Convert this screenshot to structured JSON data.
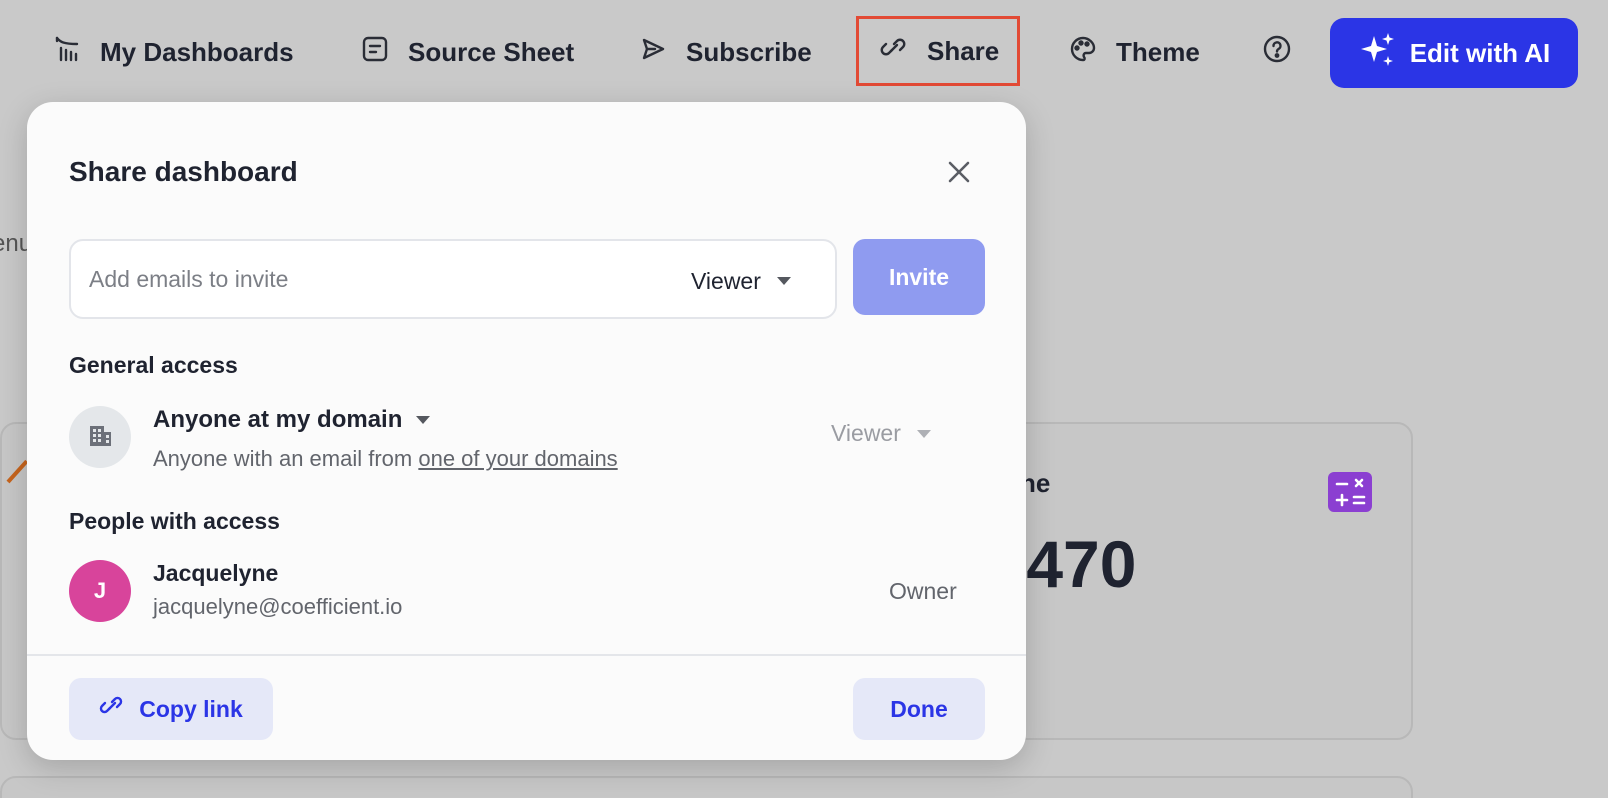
{
  "nav": {
    "dashboards_label": "My Dashboards",
    "source_label": "Source Sheet",
    "subscribe_label": "Subscribe",
    "share_label": "Share",
    "theme_label": "Theme",
    "edit_ai_label": "Edit with AI",
    "icons": [
      "dashboard-icon",
      "sheet-icon",
      "send-icon",
      "link-icon",
      "palette-icon",
      "help-icon",
      "sparkle-icon"
    ]
  },
  "background": {
    "menu_fragment": "enu",
    "card_label_fragment": "ne",
    "card_value_fragment": ",470"
  },
  "modal": {
    "title": "Share dashboard",
    "invite": {
      "placeholder": "Add emails to invite",
      "role": "Viewer",
      "button": "Invite"
    },
    "general_access": {
      "heading": "General access",
      "option": "Anyone at my domain",
      "desc_prefix": "Anyone with an email from ",
      "desc_link": "one of your domains",
      "role": "Viewer"
    },
    "people": {
      "heading": "People with access",
      "list": [
        {
          "initial": "J",
          "name": "Jacquelyne",
          "email": "jacquelyne@coefficient.io",
          "role": "Owner"
        }
      ]
    },
    "copy_link": "Copy link",
    "done": "Done"
  },
  "colors": {
    "accent": "#2b35e6",
    "share_highlight": "#e24a35",
    "avatar_pink": "#d8449b",
    "calc_purple": "#8b3fd1"
  }
}
